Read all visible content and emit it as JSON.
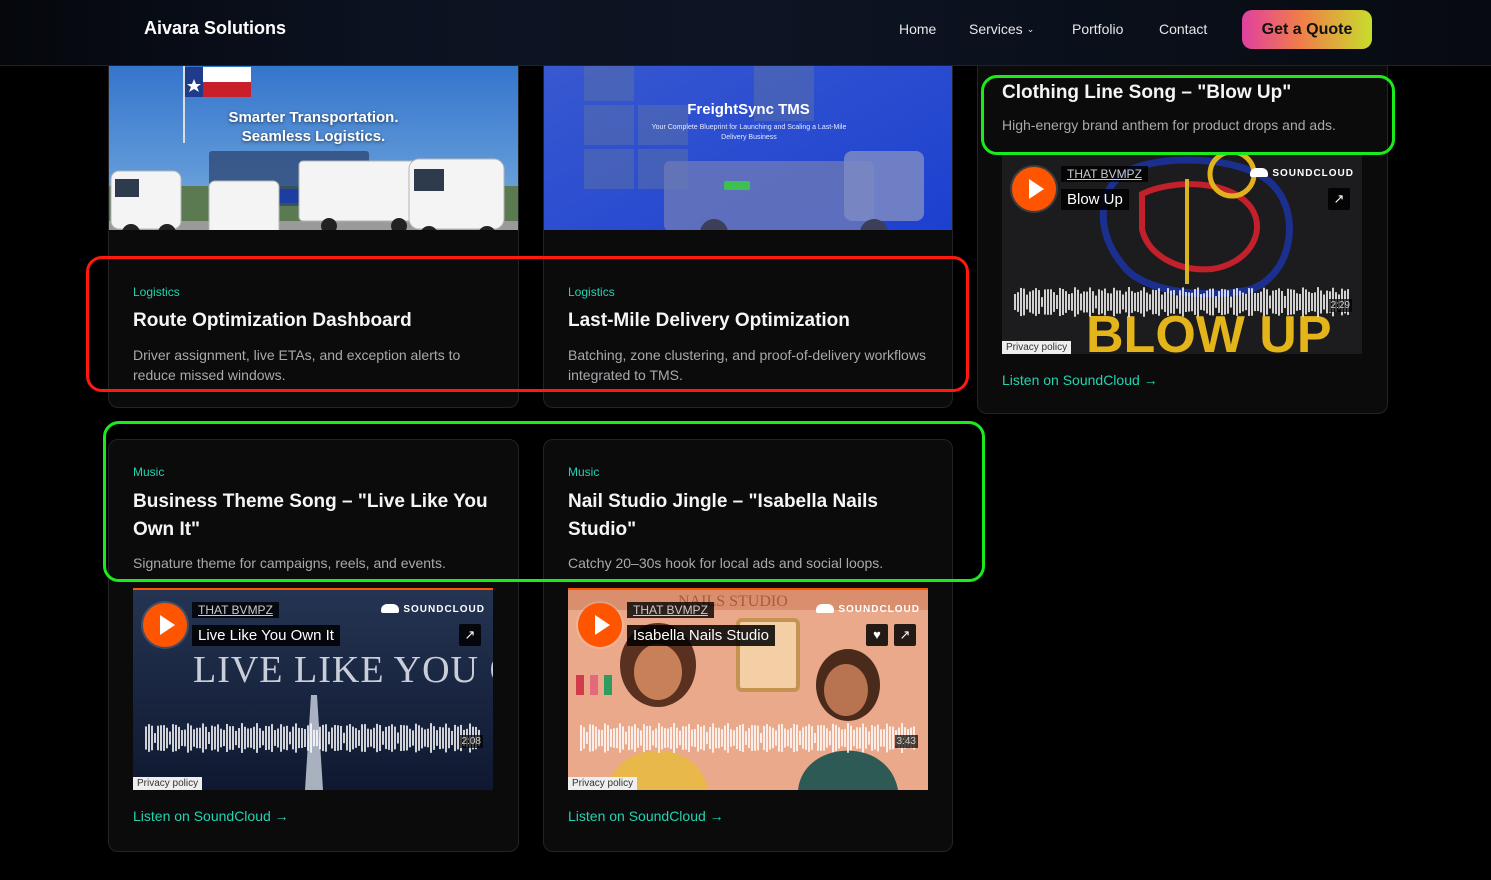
{
  "header": {
    "brand": "Aivara Solutions",
    "nav": [
      {
        "label": "Home"
      },
      {
        "label": "Services",
        "icon": "chevron-down-icon"
      },
      {
        "label": "Portfolio"
      },
      {
        "label": "Contact"
      }
    ],
    "cta": "Get a Quote"
  },
  "cards": [
    {
      "tag": "Logistics",
      "title": "Route Optimization Dashboard",
      "desc": "Driver assignment, live ETAs, and exception alerts to reduce missed windows.",
      "hero": {
        "headline": "Smarter Transportation.",
        "headline2": "Seamless Logistics."
      }
    },
    {
      "tag": "Logistics",
      "title": "Last-Mile Delivery Optimization",
      "desc": "Batching, zone clustering, and proof-of-delivery workflows integrated to TMS.",
      "hero": {
        "headline": "FreightSync TMS",
        "sub": "Your Complete Blueprint for Launching and Scaling a Last-Mile Delivery Business"
      }
    },
    {
      "tag": "Music",
      "title": "Business Theme Song – \"Live Like You Own It\"",
      "desc": "Signature theme for campaigns, reels, and events.",
      "player": {
        "artist": "THAT BVMPZ",
        "track": "Live Like You Own It",
        "duration": "2:08",
        "art_text": "LIVE LIKE YOU OWN IT"
      },
      "link": "Listen on SoundCloud →"
    },
    {
      "tag": "Music",
      "title": "Nail Studio Jingle – \"Isabella Nails Studio\"",
      "desc": "Catchy 20–30s hook for local ads and social loops.",
      "player": {
        "artist": "THAT BVMPZ",
        "track": "Isabella Nails Studio",
        "duration": "3:43",
        "art_text": "NAILS STUDIO"
      },
      "link": "Listen on SoundCloud →"
    },
    {
      "title": "Clothing Line Song – \"Blow Up\"",
      "desc": "High-energy brand anthem for product drops and ads.",
      "player": {
        "artist": "THAT BVMPZ",
        "track": "Blow Up",
        "duration": "2:29",
        "art_text": "BLOW UP"
      },
      "link": "Listen on SoundCloud →"
    }
  ],
  "soundcloud": {
    "logo": "SOUNDCLOUD",
    "privacy": "Privacy policy"
  },
  "colors": {
    "accent": "#22d3b1",
    "soundcloud": "#ff5500",
    "highlight_red": "#ff1a0d",
    "highlight_green": "#1aeb1a"
  }
}
